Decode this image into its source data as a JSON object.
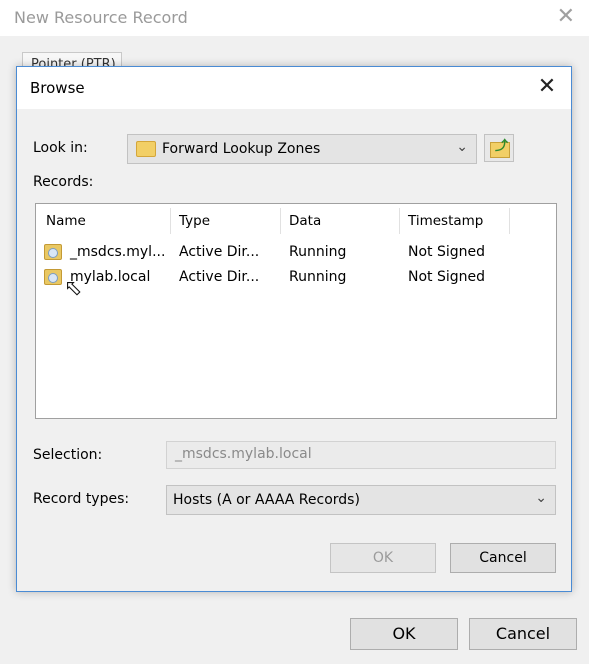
{
  "parent": {
    "title": "New Resource Record",
    "close_glyph": "✕",
    "tab_label": "Pointer (PTR)",
    "ok_label": "OK",
    "cancel_label": "Cancel"
  },
  "browse": {
    "title": "Browse",
    "close_glyph": "✕",
    "look_in_label": "Look in:",
    "look_in_value": "Forward Lookup Zones",
    "records_label": "Records:",
    "columns": [
      "Name",
      "Type",
      "Data",
      "Timestamp"
    ],
    "rows": [
      {
        "name": "_msdcs.myl...",
        "type": "Active Dir...",
        "data": "Running",
        "timestamp": "Not Signed"
      },
      {
        "name": "mylab.local",
        "type": "Active Dir...",
        "data": "Running",
        "timestamp": "Not Signed"
      }
    ],
    "selection_label": "Selection:",
    "selection_value": "_msdcs.mylab.local",
    "record_types_label": "Record types:",
    "record_types_value": "Hosts (A or AAAA Records)",
    "ok_label": "OK",
    "cancel_label": "Cancel"
  },
  "icons": {
    "folder": "folder-icon",
    "up_folder": "up-one-level-icon",
    "zone": "dns-zone-icon",
    "chevron": "chevron-down-icon",
    "cursor": "mouse-pointer-icon"
  }
}
